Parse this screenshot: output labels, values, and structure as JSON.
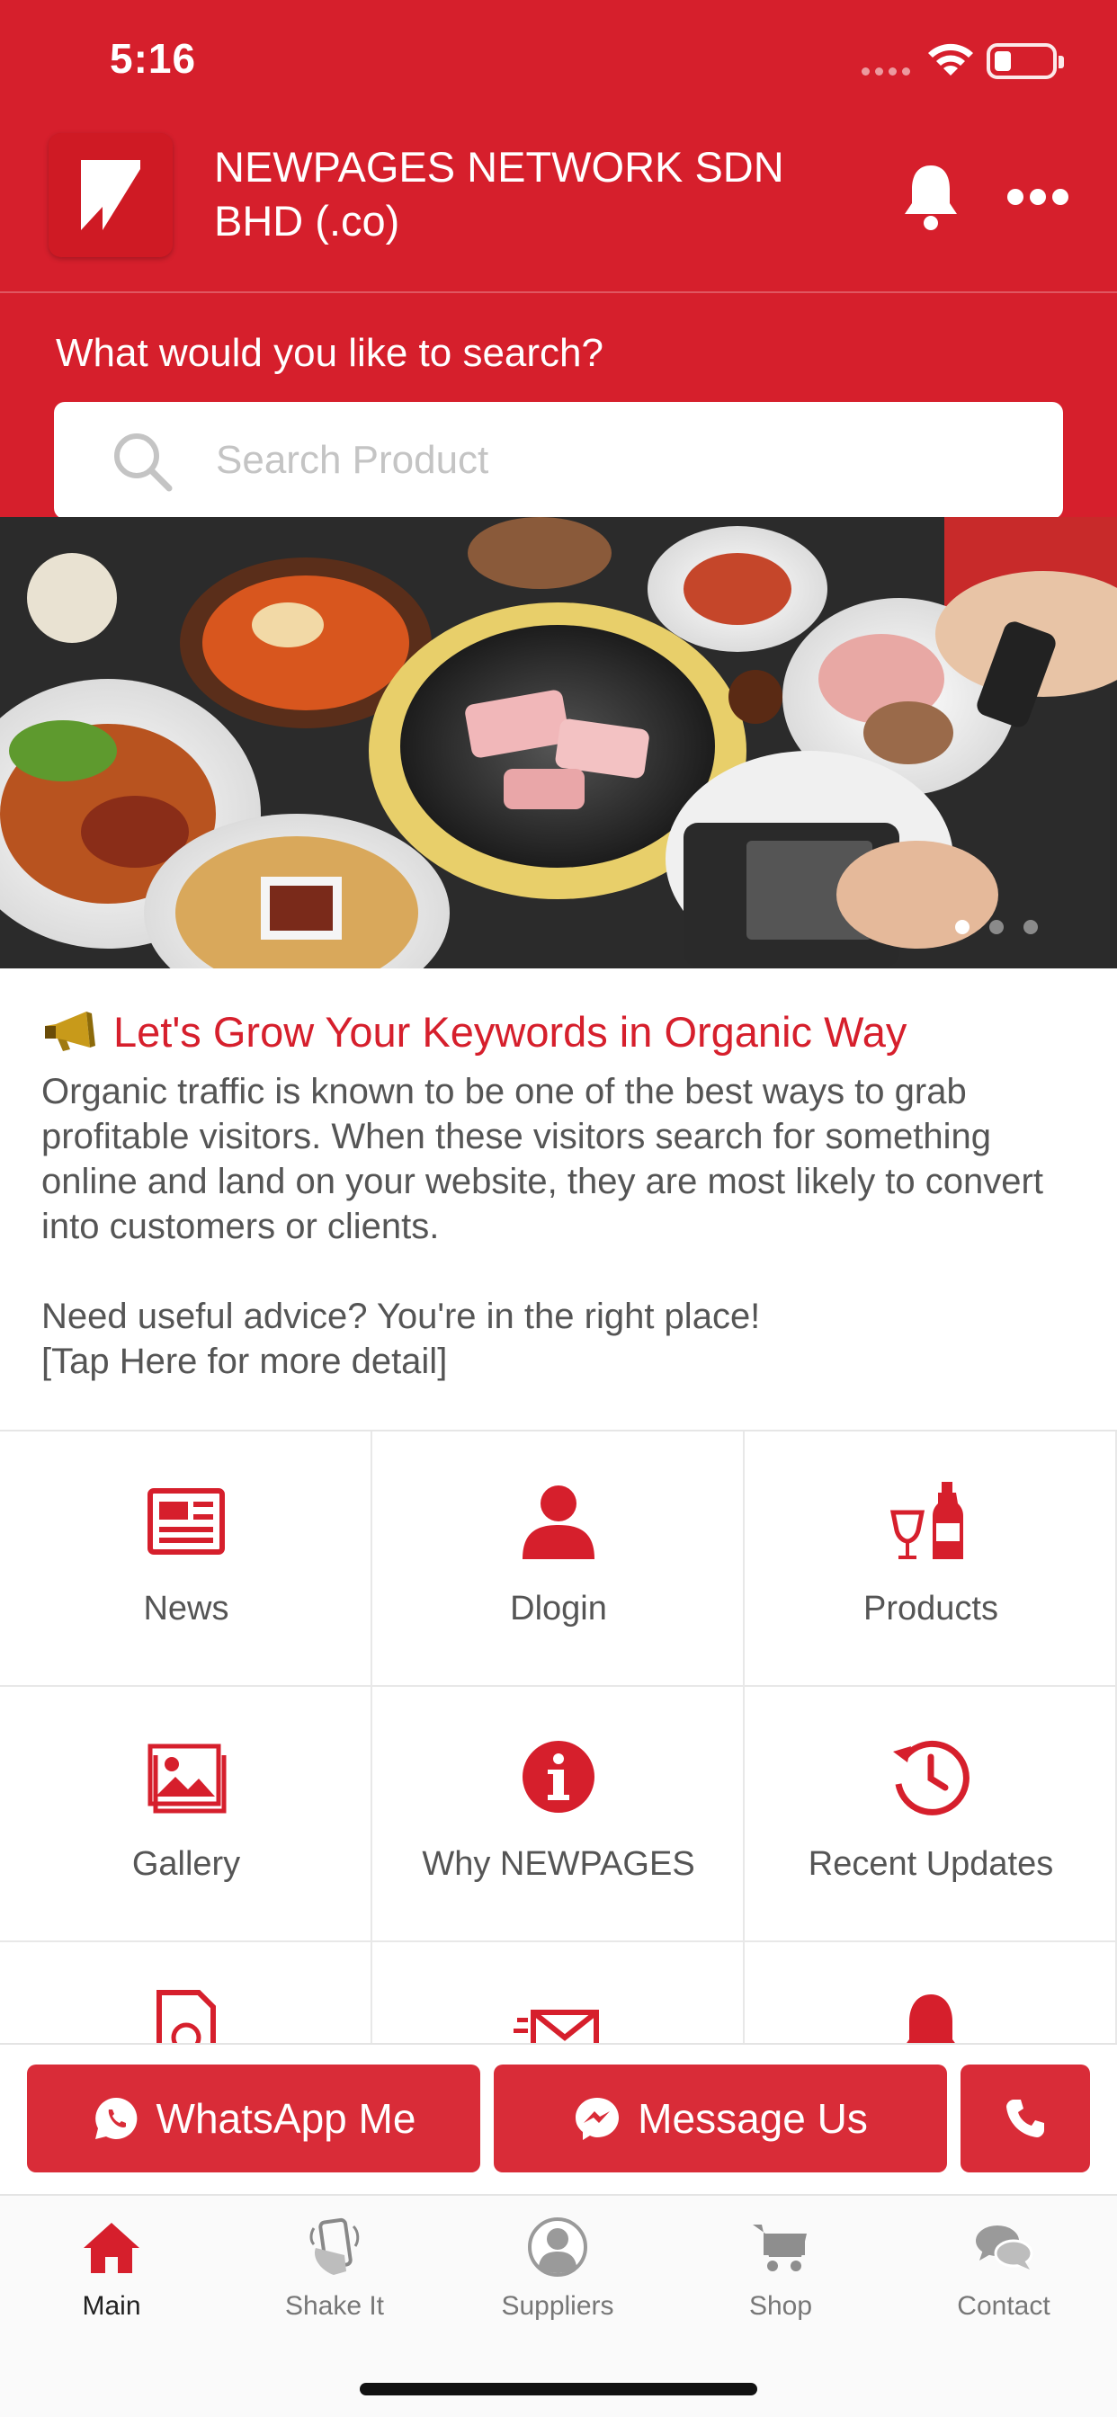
{
  "status_bar": {
    "time": "5:16"
  },
  "header": {
    "company_name": "NEWPAGES NETWORK SDN BHD (.co)"
  },
  "search": {
    "label": "What would you like to search?",
    "placeholder": "Search Product",
    "value": ""
  },
  "banner": {
    "slide_count": 3,
    "active_slide": 1
  },
  "article": {
    "title": "Let's Grow Your Keywords in Organic Way",
    "body": "Organic traffic is known to be one of the best ways to grab profitable visitors. When these visitors search for something online and land on your website, they are most likely to convert into customers or clients.\n\nNeed useful advice? You're in the right place!\n[Tap Here for more detail]"
  },
  "grid": {
    "items": [
      {
        "label": "News",
        "icon": "newspaper-icon"
      },
      {
        "label": "Dlogin",
        "icon": "user-icon"
      },
      {
        "label": "Products",
        "icon": "wine-icon"
      },
      {
        "label": "Gallery",
        "icon": "image-icon"
      },
      {
        "label": "Why NEWPAGES",
        "icon": "info-icon"
      },
      {
        "label": "Recent Updates",
        "icon": "history-icon"
      }
    ]
  },
  "actions": {
    "whatsapp_label": "WhatsApp Me",
    "message_label": "Message Us"
  },
  "tabs": [
    {
      "label": "Main",
      "icon": "home-icon",
      "active": true
    },
    {
      "label": "Shake It",
      "icon": "shake-phone-icon",
      "active": false
    },
    {
      "label": "Suppliers",
      "icon": "person-circle-icon",
      "active": false
    },
    {
      "label": "Shop",
      "icon": "cart-icon",
      "active": false
    },
    {
      "label": "Contact",
      "icon": "chat-bubbles-icon",
      "active": false
    }
  ],
  "colors": {
    "brand_red": "#d61f2c",
    "button_red": "#d92c38",
    "text_gray": "#555555"
  }
}
